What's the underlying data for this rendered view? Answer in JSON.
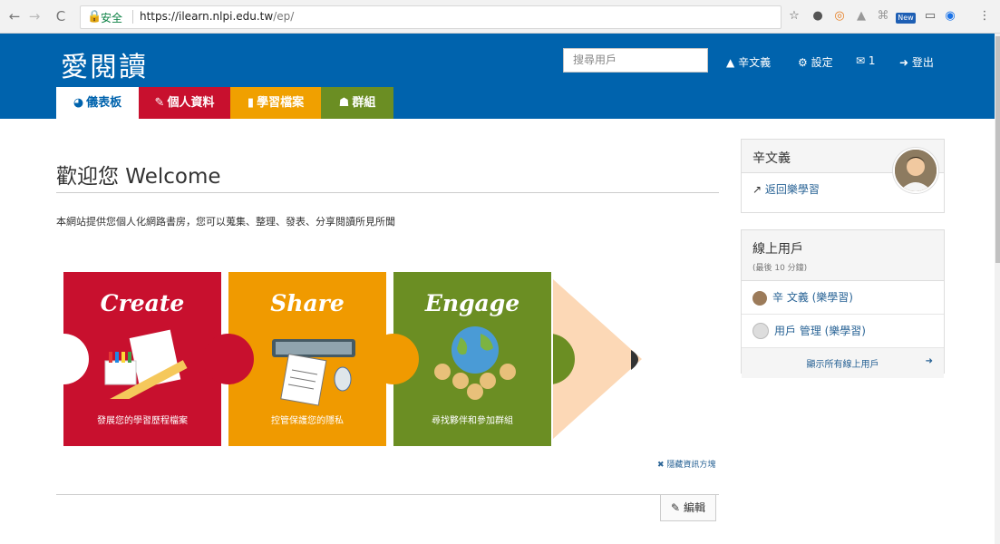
{
  "browser": {
    "back": "←",
    "forward": "→",
    "reload": "C",
    "secure": "安全",
    "url_host": "https://ilearn.nlpi.edu.tw",
    "url_path": "/ep/",
    "extensions": [
      "☆",
      "●",
      "◎",
      "▲",
      "⌘",
      "New",
      "▭",
      "◉",
      "⋮"
    ]
  },
  "header": {
    "logo": "愛閱讀",
    "search_placeholder": "搜尋用戶",
    "user": "辛文義",
    "settings": "設定",
    "mail_count": "1",
    "logout": "登出"
  },
  "tabs": [
    {
      "label": "儀表板",
      "icon": "dashboard-icon",
      "color": "#0063ad"
    },
    {
      "label": "個人資料",
      "icon": "edit-icon",
      "color": "#c8102e"
    },
    {
      "label": "學習檔案",
      "icon": "file-icon",
      "color": "#f0a000"
    },
    {
      "label": "群組",
      "icon": "users-icon",
      "color": "#6b8e23"
    }
  ],
  "main": {
    "title": "歡迎您 Welcome",
    "description": "本網站提供您個人化網路書房，您可以蒐集、整理、發表、分享閱讀所見所聞",
    "puzzle": [
      {
        "title": "Create",
        "caption": "發展您的學習歷程檔案",
        "color": "#c8102e"
      },
      {
        "title": "Share",
        "caption": "控管保護您的隱私",
        "color": "#f09a00"
      },
      {
        "title": "Engage",
        "caption": "尋找夥伴和參加群組",
        "color": "#6b8e23"
      }
    ],
    "hide_link": "✖ 隱藏資訊方塊",
    "edit_label": "編輯"
  },
  "sidebar": {
    "profile_name": "辛文義",
    "return_link": "返回樂學習",
    "online_title": "線上用戶",
    "online_sub": "(最後 10 分鐘)",
    "online_users": [
      "辛 文義 (樂學習)",
      "用戶 管理 (樂學習)"
    ],
    "show_all": "顯示所有線上用戶"
  },
  "colors": {
    "brand": "#0063ad",
    "red": "#c8102e",
    "orange": "#f09a00",
    "green": "#6b8e23"
  }
}
